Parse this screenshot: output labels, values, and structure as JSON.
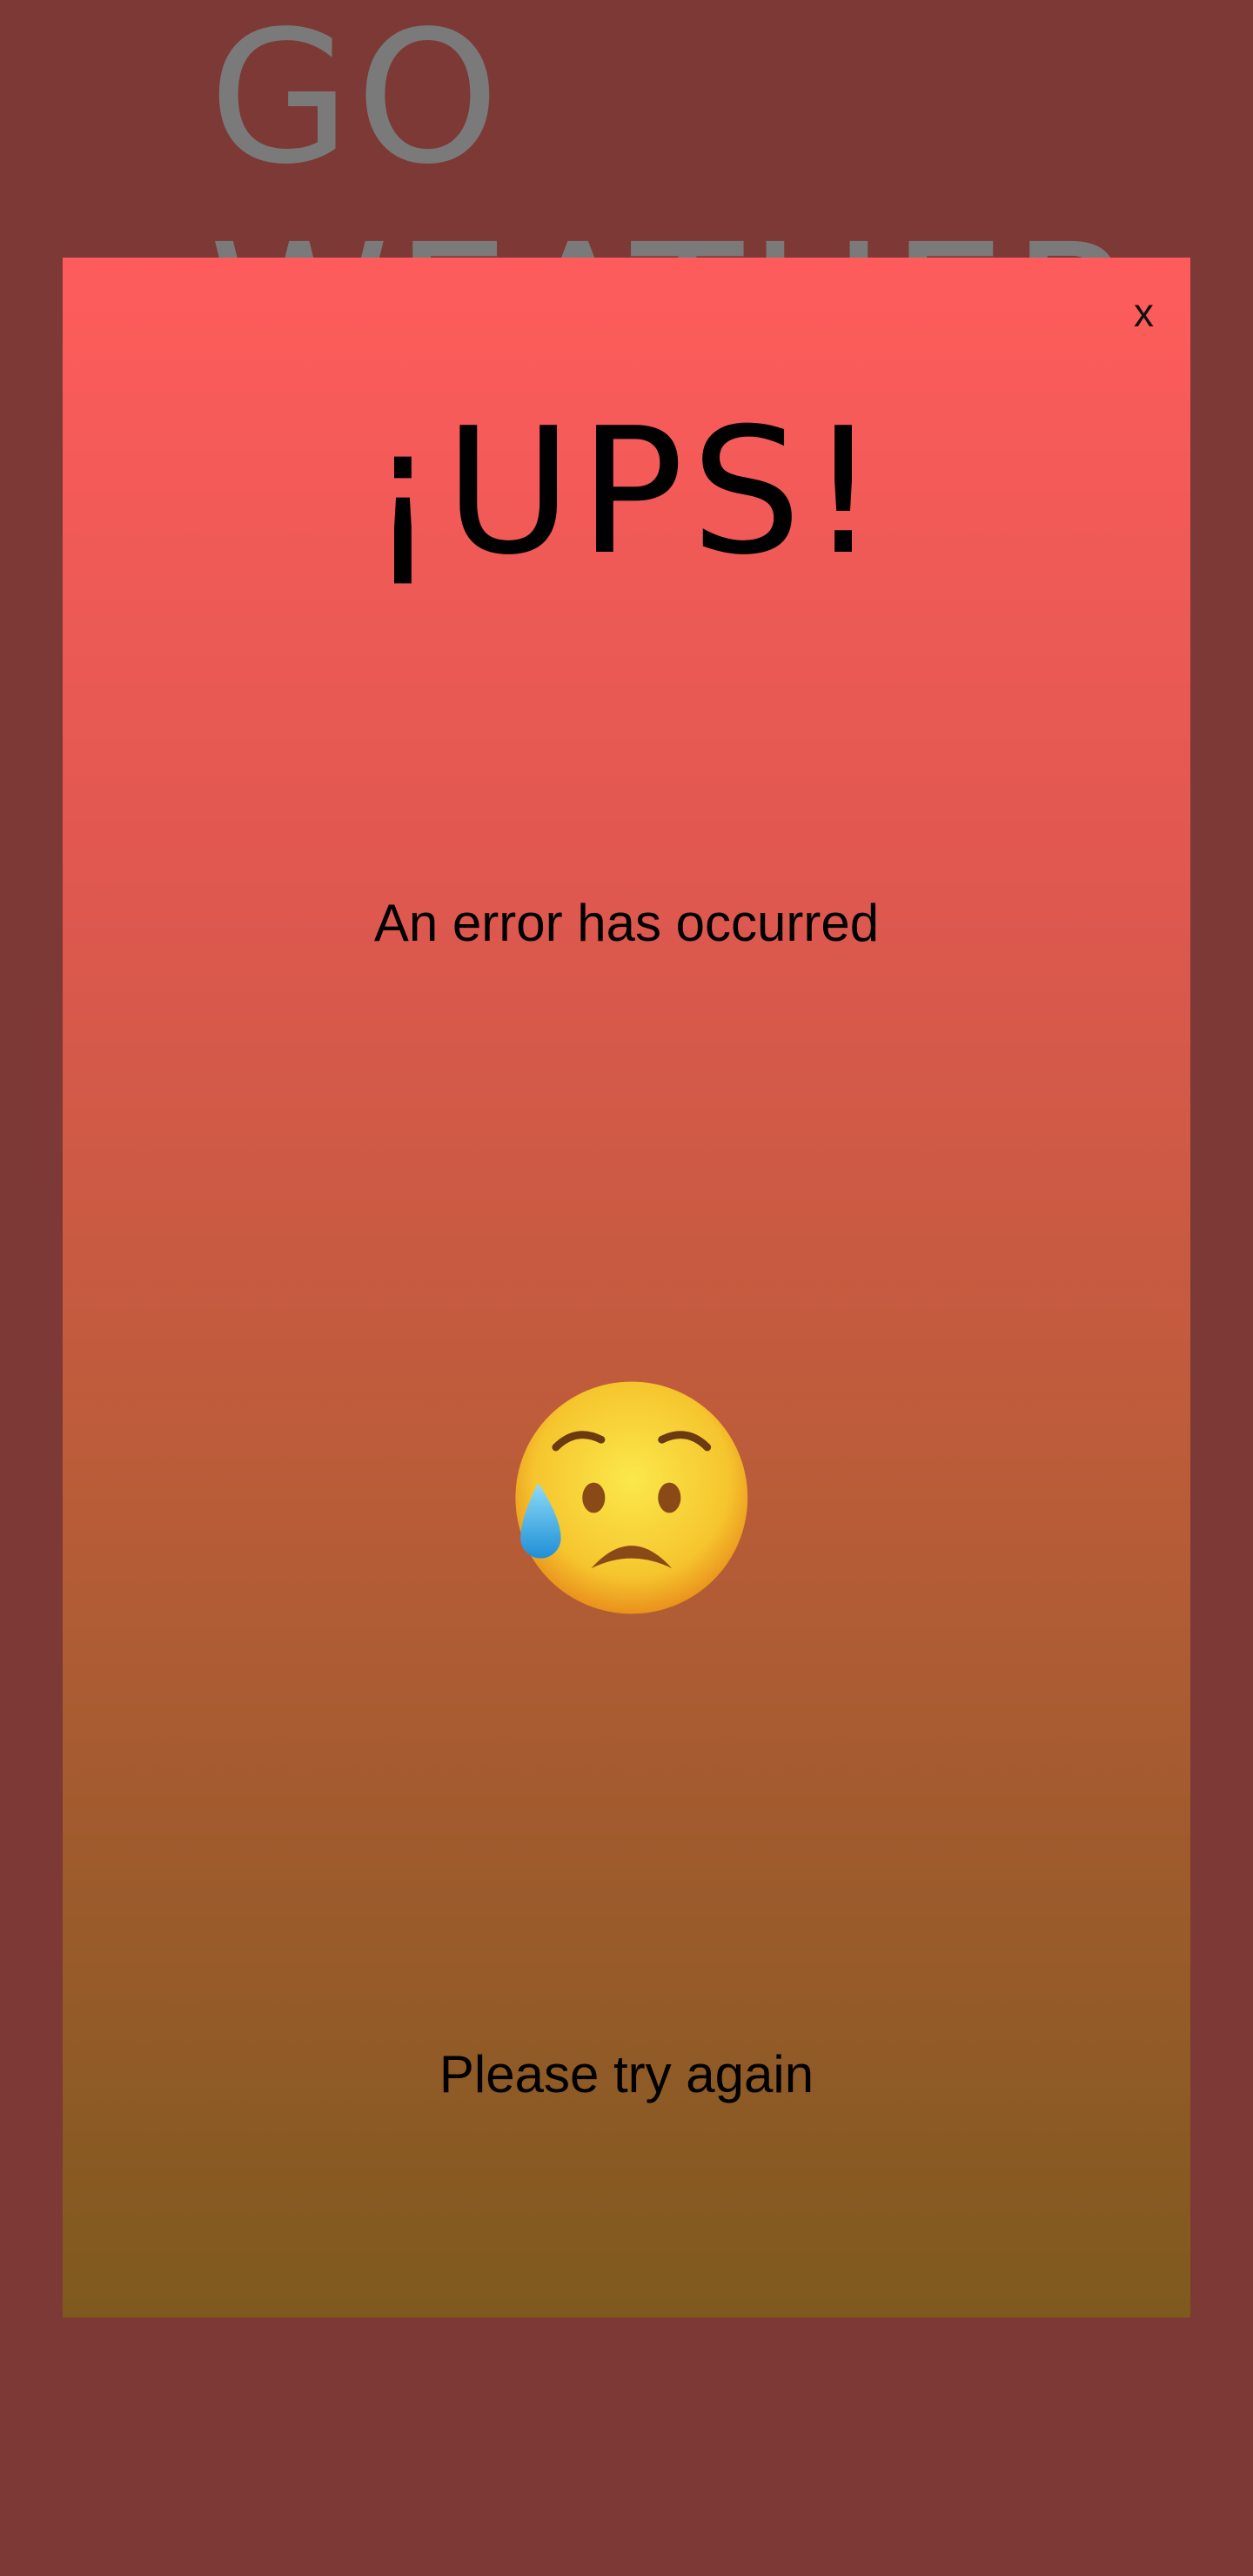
{
  "background": {
    "app_title": "GO\nWEATHER",
    "color": "#7d3935",
    "title_color": "#7a7a7a"
  },
  "modal": {
    "close_label": "x",
    "title": "¡UPS!",
    "message": "An error has occurred",
    "emoji_icon": "sad-but-relieved-face-icon",
    "retry_text": "Please try again",
    "gradient_top": "#fe5c5c",
    "gradient_bottom": "#7e5a1e"
  }
}
